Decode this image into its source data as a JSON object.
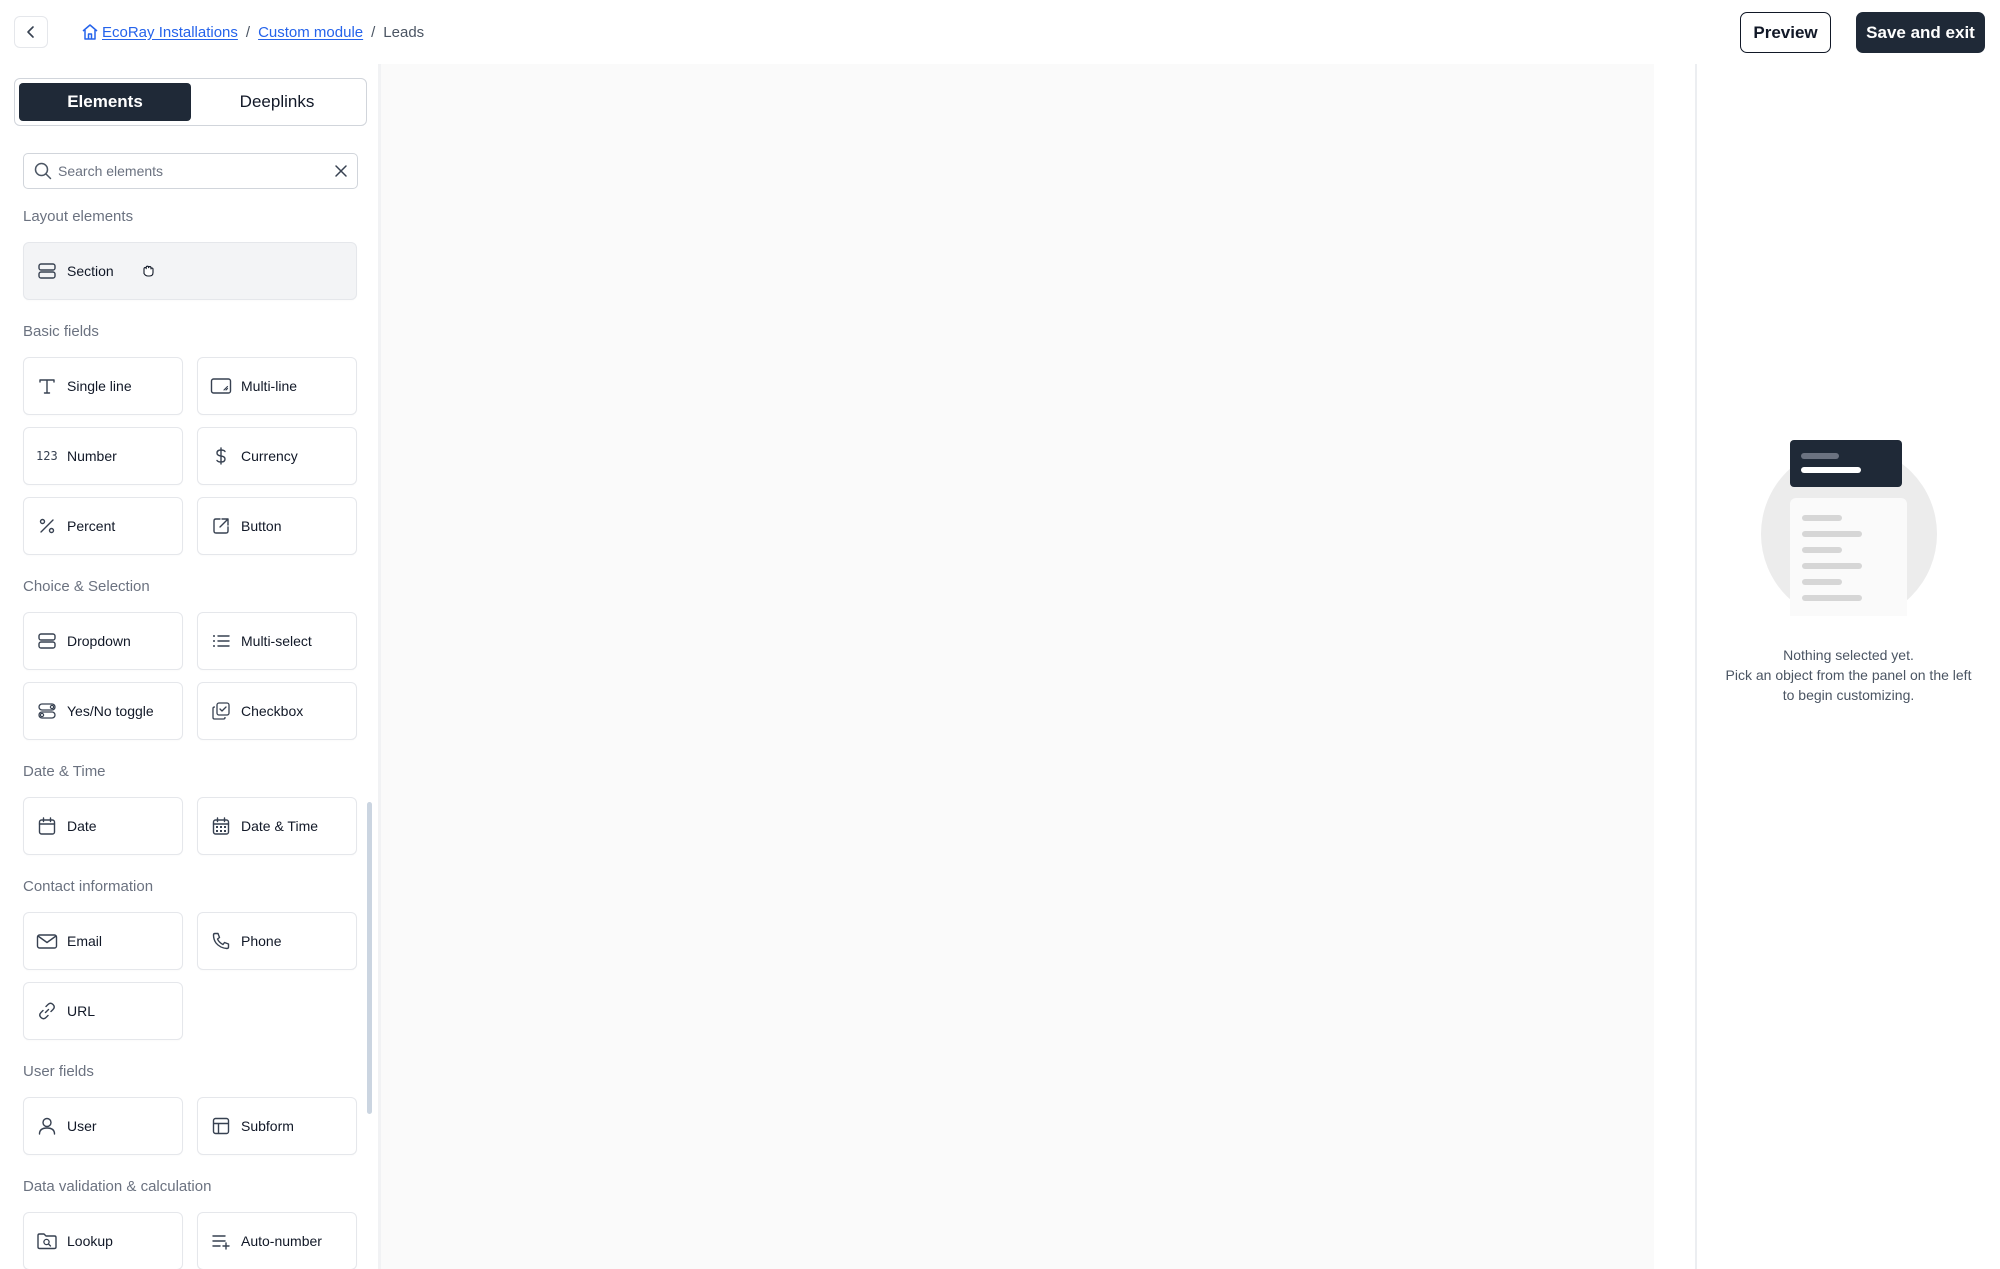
{
  "breadcrumb": {
    "items": [
      {
        "label": "EcoRay Installations"
      },
      {
        "label": "Custom module"
      },
      {
        "label": "Leads"
      }
    ],
    "separator": "/"
  },
  "header": {
    "preview_label": "Preview",
    "save_label": "Save and exit"
  },
  "left_panel": {
    "tabs": [
      {
        "label": "Elements",
        "active": true
      },
      {
        "label": "Deeplinks",
        "active": false
      }
    ],
    "search": {
      "placeholder": "Search elements",
      "value": ""
    },
    "sections": [
      {
        "title": "Layout elements",
        "items": [
          {
            "label": "Section",
            "icon": "section-icon"
          }
        ]
      },
      {
        "title": "Basic fields",
        "items": [
          {
            "label": "Single line",
            "icon": "text-icon"
          },
          {
            "label": "Multi-line",
            "icon": "textarea-icon"
          },
          {
            "label": "Number",
            "icon": "number-icon",
            "glyph": "123"
          },
          {
            "label": "Currency",
            "icon": "dollar-icon"
          },
          {
            "label": "Percent",
            "icon": "percent-icon"
          },
          {
            "label": "Button",
            "icon": "external-link-icon"
          }
        ]
      },
      {
        "title": "Choice & Selection",
        "items": [
          {
            "label": "Dropdown",
            "icon": "dropdown-icon"
          },
          {
            "label": "Multi-select",
            "icon": "list-icon"
          },
          {
            "label": "Yes/No toggle",
            "icon": "toggle-icon"
          },
          {
            "label": "Checkbox",
            "icon": "checkbox-icon"
          }
        ]
      },
      {
        "title": "Date & Time",
        "items": [
          {
            "label": "Date",
            "icon": "calendar-icon"
          },
          {
            "label": "Date & Time",
            "icon": "calendar-grid-icon"
          }
        ]
      },
      {
        "title": "Contact information",
        "items": [
          {
            "label": "Email",
            "icon": "mail-icon"
          },
          {
            "label": "Phone",
            "icon": "phone-icon"
          },
          {
            "label": "URL",
            "icon": "link-icon"
          }
        ]
      },
      {
        "title": "User fields",
        "items": [
          {
            "label": "User",
            "icon": "user-icon"
          },
          {
            "label": "Subform",
            "icon": "table-icon"
          }
        ]
      },
      {
        "title": "Data validation & calculation",
        "items": [
          {
            "label": "Lookup",
            "icon": "folder-search-icon"
          },
          {
            "label": "Auto-number",
            "icon": "list-plus-icon"
          }
        ]
      }
    ]
  },
  "right_panel": {
    "empty_title": "Nothing selected yet.",
    "empty_line1": "Pick an object from the panel on the left",
    "empty_line2": "to begin customizing."
  },
  "colors": {
    "primary_dark": "#1f2937",
    "link": "#2563eb",
    "muted_text": "#6b7280",
    "canvas_bg": "#fafafa"
  }
}
